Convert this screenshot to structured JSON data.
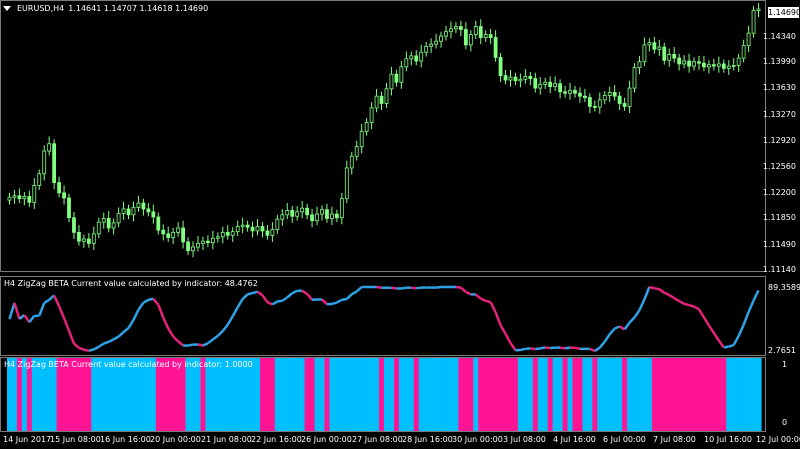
{
  "symbol": {
    "title": "EURUSD,H4",
    "ohlc": "1.14641 1.14707 1.14618 1.14690"
  },
  "price_axis": {
    "current": "1.14690",
    "labels": [
      "1.14340",
      "1.13990",
      "1.13630",
      "1.13270",
      "1.12920",
      "1.12560",
      "1.12200",
      "1.11850",
      "1.11490",
      "1.11140"
    ]
  },
  "indicator1": {
    "label": "H4 ZigZag BETA Current value calculated by indicator: 48.4762",
    "max": "89.3589",
    "min": "2.7651",
    "colors": {
      "up": "#2ea3e6",
      "down": "#e6227a"
    }
  },
  "indicator2": {
    "label": "H4 ZigZag BETA Current value calculated by indicator: 1.0000",
    "max": "1",
    "min": "0",
    "colors": {
      "up": "#00bfff",
      "down": "#ff1493"
    }
  },
  "time_axis": {
    "labels": [
      "14 Jun 2017",
      "15 Jun 08:00",
      "16 Jun 16:00",
      "20 Jun 00:00",
      "21 Jun 08:00",
      "22 Jun 16:00",
      "26 Jun 00:00",
      "27 Jun 08:00",
      "28 Jun 16:00",
      "30 Jun 00:00",
      "3 Jul 08:00",
      "4 Jul 16:00",
      "6 Jul 00:00",
      "7 Jul 08:00",
      "10 Jul 16:00",
      "12 Jul 00:00"
    ]
  },
  "chart_data": {
    "type": "candlestick",
    "up_color": "#80ff80",
    "closes": [
      1.1212,
      1.1214,
      1.121,
      1.1213,
      1.1205,
      1.1228,
      1.1244,
      1.1275,
      1.1285,
      1.1232,
      1.1218,
      1.1211,
      1.1184,
      1.1164,
      1.1152,
      1.1155,
      1.1149,
      1.1162,
      1.1178,
      1.1183,
      1.117,
      1.1177,
      1.119,
      1.1196,
      1.1188,
      1.1198,
      1.1204,
      1.1196,
      1.1192,
      1.1185,
      1.1167,
      1.1162,
      1.1157,
      1.1164,
      1.117,
      1.1151,
      1.1139,
      1.1144,
      1.1149,
      1.1152,
      1.115,
      1.1156,
      1.1158,
      1.1164,
      1.116,
      1.1165,
      1.1172,
      1.1174,
      1.1171,
      1.1166,
      1.1172,
      1.1166,
      1.116,
      1.1168,
      1.1182,
      1.1188,
      1.1194,
      1.1186,
      1.1192,
      1.1197,
      1.1188,
      1.118,
      1.1189,
      1.1195,
      1.1183,
      1.1189,
      1.1184,
      1.121,
      1.1252,
      1.1268,
      1.1281,
      1.1302,
      1.1314,
      1.1334,
      1.135,
      1.134,
      1.136,
      1.138,
      1.1369,
      1.139,
      1.1401,
      1.1405,
      1.1398,
      1.141,
      1.1418,
      1.1421,
      1.1425,
      1.1432,
      1.1438,
      1.1442,
      1.1445,
      1.1441,
      1.142,
      1.1434,
      1.1445,
      1.143,
      1.1434,
      1.143,
      1.1403,
      1.1378,
      1.1372,
      1.1376,
      1.1371,
      1.1373,
      1.1377,
      1.1374,
      1.1361,
      1.1366,
      1.1369,
      1.1363,
      1.1367,
      1.1356,
      1.1354,
      1.1358,
      1.1354,
      1.135,
      1.1348,
      1.1336,
      1.1335,
      1.1345,
      1.1351,
      1.1355,
      1.135,
      1.134,
      1.1336,
      1.1361,
      1.1389,
      1.1397,
      1.142,
      1.1423,
      1.1414,
      1.1417,
      1.1399,
      1.1407,
      1.1402,
      1.1394,
      1.1398,
      1.1391,
      1.1397,
      1.1395,
      1.139,
      1.1393,
      1.1391,
      1.1394,
      1.1388,
      1.1391,
      1.1392,
      1.1402,
      1.1419,
      1.1436,
      1.1467,
      1.1469
    ],
    "ylim": [
      1.1114,
      1.1469
    ]
  }
}
